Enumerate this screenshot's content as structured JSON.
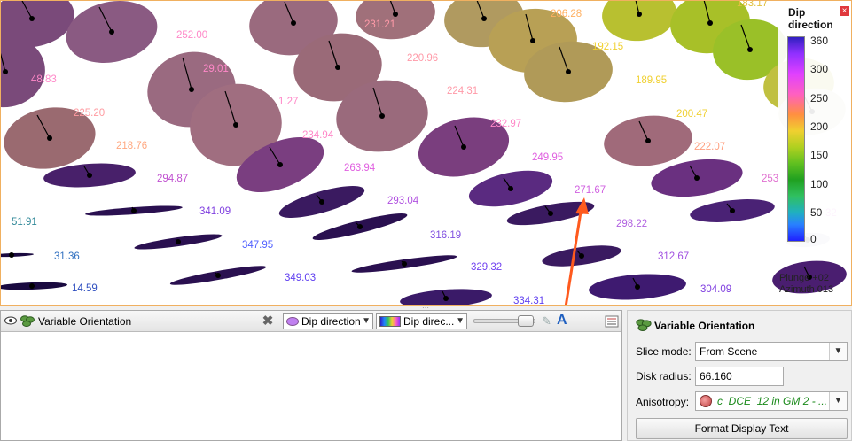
{
  "legend": {
    "title": "Dip direction",
    "ticks": [
      "360",
      "300",
      "250",
      "200",
      "150",
      "100",
      "50",
      "0"
    ]
  },
  "view_info": {
    "plunge": "Plunge +02",
    "azimuth": "Azimuth 013"
  },
  "disk_labels": [
    "252.00",
    "231.21",
    "206.28",
    "183.17",
    "192.15",
    "48.83",
    "29.01",
    "220.96",
    "189.95",
    "225.20",
    "1.27",
    "224.31",
    "200.47",
    "232.97",
    "218.76",
    "234.94",
    "222.07",
    "249.95",
    "263.94",
    "294.87",
    "253",
    "271.67",
    "293.04",
    "51.91",
    "341.09",
    "298.22",
    "347.95",
    "316.19",
    "31.36",
    "312.67",
    "329.32",
    "349.03",
    "14.59",
    "304.09",
    "334.31",
    "32"
  ],
  "layer_panel": {
    "title": "Variable Orientation",
    "attribute": "Dip direction",
    "colormap": "Dip direc...",
    "remove_icon": "close-x-icon"
  },
  "properties": {
    "title": "Variable Orientation",
    "slice_mode_label": "Slice mode:",
    "slice_mode_value": "From Scene",
    "disk_radius_label": "Disk radius:",
    "disk_radius_value": "66.160",
    "anisotropy_label": "Anisotropy:",
    "anisotropy_value": "c_DCE_12 in GM 2 - ...",
    "format_button": "Format Display Text"
  }
}
